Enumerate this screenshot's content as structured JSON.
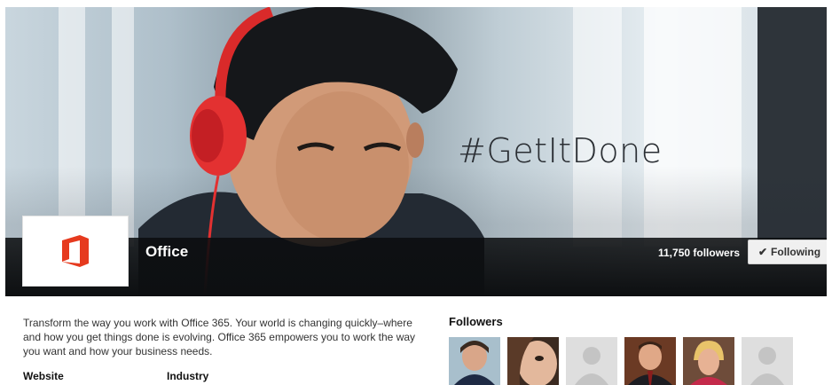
{
  "cover": {
    "hashtag": "#GetItDone"
  },
  "company": {
    "name": "Office",
    "logo": "office-logo",
    "brand_color": "#e63a1e"
  },
  "follow": {
    "count_text": "11,750 followers",
    "button_label": "Following",
    "button_icon": "checkmark-icon"
  },
  "about": {
    "description": "Transform the way you work with Office 365. Your world is changing quickly–where and how you get things done is evolving. Office 365 empowers you to work the way you want and how your business needs.",
    "website_label": "Website",
    "industry_label": "Industry"
  },
  "followers_panel": {
    "title": "Followers",
    "avatars": [
      {
        "kind": "photo",
        "name": "follower-avatar-1"
      },
      {
        "kind": "photo",
        "name": "follower-avatar-2"
      },
      {
        "kind": "placeholder",
        "name": "follower-avatar-3"
      },
      {
        "kind": "photo",
        "name": "follower-avatar-4"
      },
      {
        "kind": "photo",
        "name": "follower-avatar-5"
      },
      {
        "kind": "placeholder",
        "name": "follower-avatar-6"
      }
    ]
  }
}
